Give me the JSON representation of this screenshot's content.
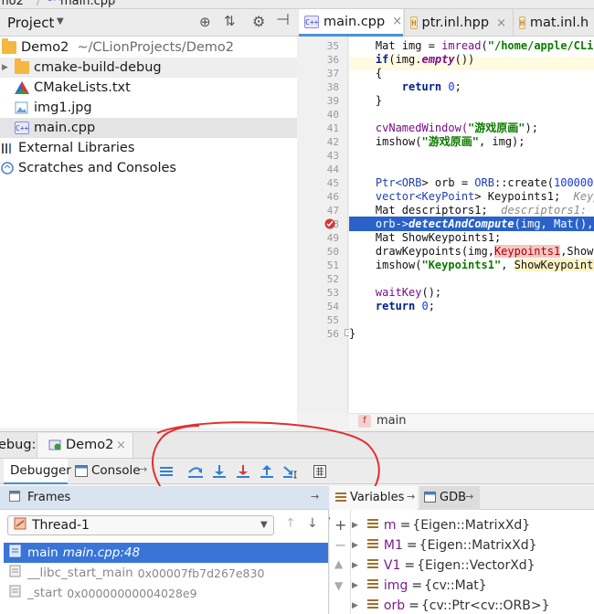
{
  "window": {
    "crumb_project": "mo2",
    "crumb_file": "main.cpp"
  },
  "project_panel": {
    "title": "Project",
    "tree": [
      {
        "label": "Demo2",
        "path": "~/CLionProjects/Demo2",
        "icon": "folder-icon"
      },
      {
        "label": "cmake-build-debug",
        "icon": "folder-icon"
      },
      {
        "label": "CMakeLists.txt",
        "icon": "cmake-icon"
      },
      {
        "label": "img1.jpg",
        "icon": "image-file-icon"
      },
      {
        "label": "main.cpp",
        "icon": "cpp-file-icon"
      },
      {
        "label": "External Libraries",
        "icon": "library-icon"
      },
      {
        "label": "Scratches and Consoles",
        "icon": "scratches-icon"
      }
    ]
  },
  "editor": {
    "tabs": [
      {
        "label": "main.cpp",
        "badge": "C++",
        "active": true
      },
      {
        "label": "ptr.inl.hpp",
        "badge": "H",
        "active": false
      },
      {
        "label": "mat.inl.h",
        "badge": "H",
        "active": false
      }
    ],
    "line_numbers": [
      "35",
      "36",
      "37",
      "38",
      "39",
      "40",
      "41",
      "42",
      "43",
      "44",
      "45",
      "46",
      "47",
      "48",
      "49",
      "50",
      "51",
      "52",
      "53",
      "54",
      "55",
      "56"
    ],
    "code": {
      "l35a": "    Mat img = ",
      "l35b": "imread",
      "l35c": "(",
      "l35d": "\"/home/apple/CLio",
      "l36a": "    ",
      "l36b": "if",
      "l36c": "(img.",
      "l36d": "empty",
      "l36e": "())",
      "l37": "    {",
      "l38a": "        ",
      "l38b": "return",
      "l38c": " ",
      "l38d": "0",
      "l38e": ";",
      "l39": "    }",
      "l41a": "    cvNamedWindow(",
      "l41b": "\"游戏原画\"",
      "l41c": ");",
      "l42a": "    imshow(",
      "l42b": "\"游戏原画\"",
      "l42c": ", img);",
      "l45a": "    Ptr<",
      "l45b": "ORB",
      "l45c": "> orb = ",
      "l45d": "ORB",
      "l45e": "::create(",
      "l45f": "100000",
      "l46a": "    vector<",
      "l46b": "KeyPoint",
      "l46c": "> Keypoints1;  ",
      "l46d": "Keyp",
      "l47a": "    Mat descriptors1;  ",
      "l47b": "descriptors1: d",
      "l48a": "    orb->",
      "l48b": "detectAndCompute",
      "l48c": "(img, Mat(),",
      "l49": "    Mat ShowKeypoints1;",
      "l50a": "    drawKeypoints(img,",
      "l50b": "Keypoints1",
      "l50c": ",ShowK",
      "l51a": "    imshow(",
      "l51b": "\"Keypoints1\"",
      "l51c": ", ",
      "l51d": "ShowKeypoints",
      "l53a": "    ",
      "l53b": "waitKey",
      "l53c": "();",
      "l54a": "    ",
      "l54b": "return",
      "l54c": " ",
      "l54d": "0",
      "l54e": ";",
      "l56": "}"
    },
    "breadcrumb_fn_badge": "f",
    "breadcrumb": "main"
  },
  "debug": {
    "label": "ebug:",
    "session": "Demo2",
    "tabs": [
      {
        "label": "Debugger",
        "active": true
      },
      {
        "label": "Console",
        "active": false
      }
    ],
    "frames": {
      "title": "Frames",
      "thread": "Thread-1",
      "rows": [
        {
          "fn": "main",
          "loc": "main.cpp:48",
          "selected": true
        },
        {
          "fn": "__libc_start_main",
          "loc": "0x00007fb7d267e830",
          "selected": false
        },
        {
          "fn": "_start",
          "loc": "0x00000000004028e9",
          "selected": false
        }
      ]
    },
    "variables": {
      "tabs": [
        {
          "label": "Variables",
          "active": true
        },
        {
          "label": "GDB",
          "active": false
        }
      ],
      "rows": [
        {
          "name": "m",
          "value": "{Eigen::MatrixXd}"
        },
        {
          "name": "M1",
          "value": "{Eigen::MatrixXd}"
        },
        {
          "name": "V1",
          "value": "{Eigen::VectorXd}"
        },
        {
          "name": "img",
          "value": "{cv::Mat}"
        },
        {
          "name": "orb",
          "value": "{cv::Ptr<cv::ORB>}"
        }
      ]
    }
  },
  "colors": {
    "selection": "#3875d7",
    "execution_line": "#2a62c9",
    "breakpoint": "#d93535",
    "annotation_circle": "#e03030",
    "step_arrows": "#2f7fd8"
  }
}
